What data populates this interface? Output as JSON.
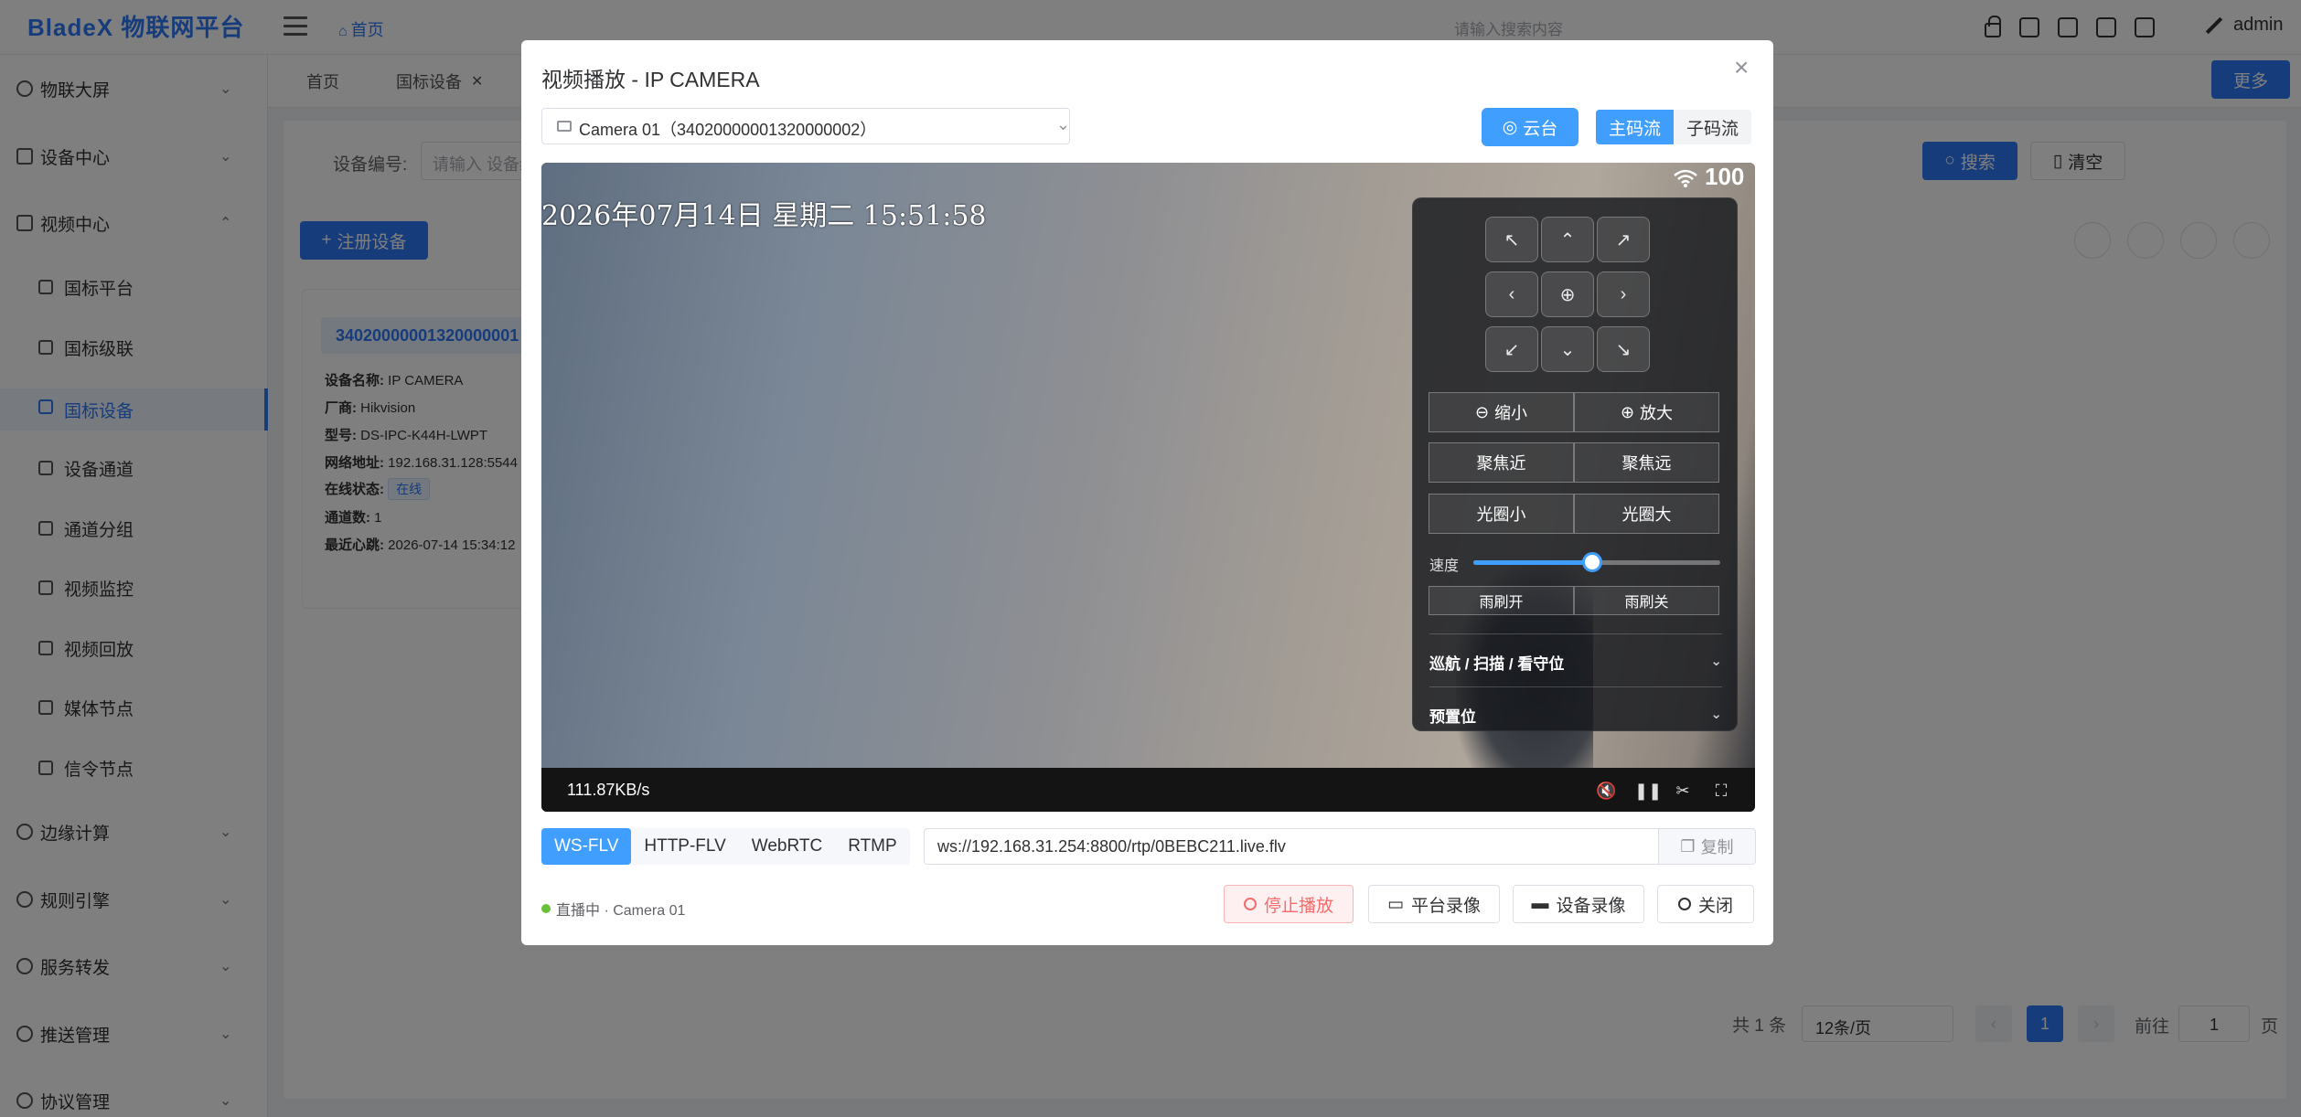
{
  "app": {
    "brand": "BladeX 物联网平台"
  },
  "header": {
    "breadcrumb_home": "首页",
    "search_placeholder": "请输入搜索内容",
    "user": "admin",
    "icons": [
      "lock-icon",
      "shirt-icon",
      "image-icon",
      "fullscreen-icon",
      "tool-icon"
    ]
  },
  "sidebar": {
    "items": [
      {
        "label": "物联大屏",
        "icon": "dashboard-icon"
      },
      {
        "label": "设备中心",
        "icon": "grid-icon"
      },
      {
        "label": "视频中心",
        "icon": "video-icon"
      },
      {
        "label": "国标平台",
        "icon": "platform-icon"
      },
      {
        "label": "国标级联",
        "icon": "cascade-icon"
      },
      {
        "label": "国标设备",
        "icon": "device-icon"
      },
      {
        "label": "设备通道",
        "icon": "channel-icon"
      },
      {
        "label": "通道分组",
        "icon": "group-icon"
      },
      {
        "label": "视频监控",
        "icon": "monitor-icon"
      },
      {
        "label": "视频回放",
        "icon": "playback-icon"
      },
      {
        "label": "媒体节点",
        "icon": "media-node-icon"
      },
      {
        "label": "信令节点",
        "icon": "signal-node-icon"
      },
      {
        "label": "边缘计算",
        "icon": "edge-icon"
      },
      {
        "label": "规则引擎",
        "icon": "rules-icon"
      },
      {
        "label": "服务转发",
        "icon": "forward-icon"
      },
      {
        "label": "推送管理",
        "icon": "bell-icon"
      },
      {
        "label": "协议管理",
        "icon": "protocol-icon"
      }
    ]
  },
  "tabs": {
    "home": "首页",
    "current": "国标设备",
    "more": "更多"
  },
  "filters": {
    "device_no_label": "设备编号:",
    "device_no_placeholder": "请输入 设备编号",
    "search": "搜索",
    "clear": "清空",
    "register": "注册设备"
  },
  "device_card": {
    "id": "34020000001320000001",
    "rows": [
      {
        "k": "设备名称:",
        "v": "IP CAMERA"
      },
      {
        "k": "厂商:",
        "v": "Hikvision"
      },
      {
        "k": "型号:",
        "v": "DS-IPC-K44H-LWPT"
      },
      {
        "k": "网络地址:",
        "v": "192.168.31.128:5544"
      },
      {
        "k": "在线状态:",
        "v": "在线"
      },
      {
        "k": "通道数:",
        "v": "1"
      },
      {
        "k": "最近心跳:",
        "v": "2026-07-14 15:34:12"
      }
    ]
  },
  "pagination": {
    "total": "共 1 条",
    "page_size": "12条/页",
    "current": "1",
    "goto": "前往",
    "goto_value": "1",
    "page_suffix": "页"
  },
  "modal": {
    "title": "视频播放 - IP CAMERA",
    "camera": "Camera 01（34020000001320000002）",
    "ptz_button": "云台",
    "main_stream": "主码流",
    "sub_stream": "子码流",
    "osd_time": "2026年07月14日 星期二 15:51:58",
    "signal": "100",
    "bitrate": "111.87KB/s",
    "ptz": {
      "zoom_out": "缩小",
      "zoom_in": "放大",
      "focus_near": "聚焦近",
      "focus_far": "聚焦远",
      "iris_small": "光圈小",
      "iris_large": "光圈大",
      "speed_label": "速度",
      "speed_value": 0.48,
      "wiper_on": "雨刷开",
      "wiper_off": "雨刷关",
      "cruise_section": "巡航 / 扫描 / 看守位",
      "preset_section": "预置位"
    },
    "protocols": [
      "WS-FLV",
      "HTTP-FLV",
      "WebRTC",
      "RTMP"
    ],
    "active_protocol": "WS-FLV",
    "url": "ws://192.168.31.254:8800/rtp/0BEBC211.live.flv",
    "copy": "复制",
    "live_status": "直播中 · Camera 01",
    "stop": "停止播放",
    "platform_record": "平台录像",
    "device_record": "设备录像",
    "close": "关闭"
  },
  "colors": {
    "primary": "#2d79f6",
    "accent": "#409eff",
    "danger": "#f56c6c",
    "online": "#67c23a"
  }
}
